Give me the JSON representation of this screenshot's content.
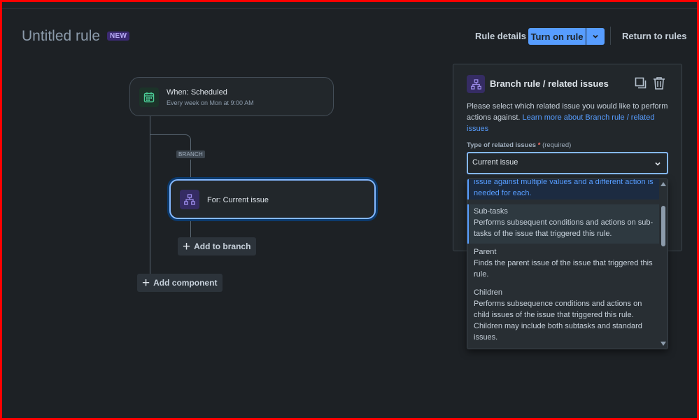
{
  "header": {
    "title": "Untitled rule",
    "badge": "NEW",
    "rule_details": "Rule details",
    "turn_on": "Turn on rule",
    "return": "Return to rules"
  },
  "trigger": {
    "title": "When: Scheduled",
    "subtitle": "Every week on Mon at 9:00 AM",
    "icon": "calendar-icon"
  },
  "branch_tag": "BRANCH",
  "branch_node": {
    "title": "For: Current issue",
    "icon": "branch-icon"
  },
  "add_to_branch": "Add to branch",
  "add_component": "Add component",
  "panel": {
    "title": "Branch rule / related issues",
    "description": "Please select which related issue you would like to perform actions against. ",
    "link": "Learn more about Branch rule / related issues",
    "field_label": "Type of related issues",
    "required_mark": "*",
    "required_text": "(required)",
    "selected_value": "Current issue"
  },
  "dropdown": {
    "partial_text": "issue against multiple values and a different action is needed for each.",
    "options": [
      {
        "name": "Sub-tasks",
        "desc": "Performs subsequent conditions and actions on sub-tasks of the issue that triggered this rule."
      },
      {
        "name": "Parent",
        "desc": "Finds the parent issue of the issue that triggered this rule."
      },
      {
        "name": "Children",
        "desc": "Performs subsequence conditions and actions on child issues of the issue that triggered this rule. Children may include both subtasks and standard issues."
      }
    ]
  },
  "colors": {
    "accent": "#579dff",
    "background": "#1d2125",
    "node": "#22272b"
  }
}
